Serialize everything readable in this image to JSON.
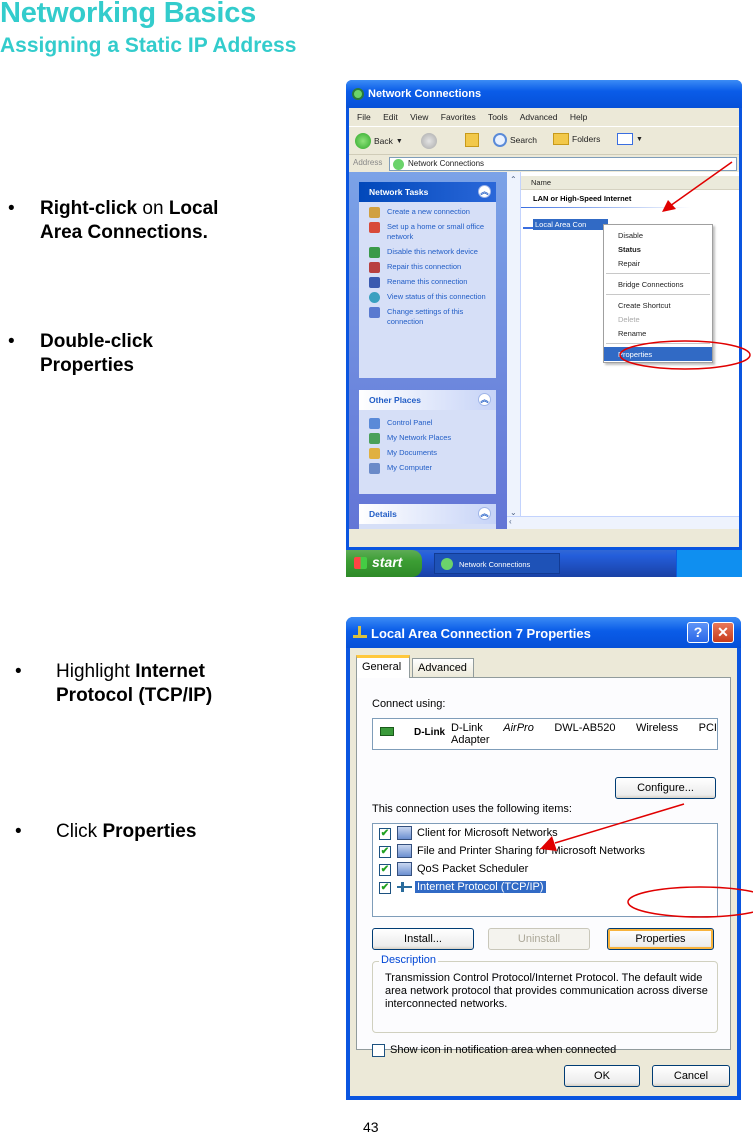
{
  "page": {
    "title": "Networking Basics",
    "subtitle": "Assigning a Static IP Address",
    "page_number": "43"
  },
  "instructions": [
    {
      "parts": [
        {
          "text": "Right-click",
          "bold": true
        },
        {
          "text": " on ",
          "bold": false
        },
        {
          "text": "Local Area Connections.",
          "bold": true
        }
      ]
    },
    {
      "parts": [
        {
          "text": "Double-click Properties",
          "bold": true
        }
      ]
    },
    {
      "parts": [
        {
          "text": "Highlight ",
          "bold": false
        },
        {
          "text": "Internet Protocol (TCP/IP)",
          "bold": true
        }
      ]
    },
    {
      "parts": [
        {
          "text": "Click ",
          "bold": false
        },
        {
          "text": "Properties",
          "bold": true
        }
      ]
    }
  ],
  "instr_text": {
    "i1_a": "Right-click",
    "i1_b": " on ",
    "i1_c": "Local",
    "i1_d": "Area Connections.",
    "i2_a": "Double-click",
    "i2_b": "Properties",
    "i3_a": "Highlight ",
    "i3_b": "Internet",
    "i3_c": "Protocol (TCP/IP)",
    "i4_a": "Click ",
    "i4_b": "Properties",
    "bullet": "•"
  },
  "network_connections": {
    "window_title": "Network Connections",
    "menu": [
      "File",
      "Edit",
      "View",
      "Favorites",
      "Tools",
      "Advanced",
      "Help"
    ],
    "toolbar": {
      "back": "Back",
      "search": "Search",
      "folders": "Folders"
    },
    "address_label": "Address",
    "address_value": "Network Connections",
    "network_tasks": {
      "header": "Network Tasks",
      "items": [
        "Create a new connection",
        "Set up a home or small office network",
        "Disable this network device",
        "Repair this connection",
        "Rename this connection",
        "View status of this connection",
        "Change settings of this connection"
      ]
    },
    "other_places": {
      "header": "Other Places",
      "items": [
        "Control Panel",
        "My Network Places",
        "My Documents",
        "My Computer"
      ]
    },
    "details_header": "Details",
    "column_header": "Name",
    "group_label": "LAN or High-Speed Internet",
    "connection_item": "Local Area Con",
    "context_menu": [
      {
        "label": "Disable",
        "style": "normal"
      },
      {
        "label": "Status",
        "style": "bold"
      },
      {
        "label": "Repair",
        "style": "normal"
      },
      {
        "label": "Bridge Connections",
        "style": "normal"
      },
      {
        "label": "Create Shortcut",
        "style": "normal"
      },
      {
        "label": "Delete",
        "style": "disabled"
      },
      {
        "label": "Rename",
        "style": "normal"
      },
      {
        "label": "Properties",
        "style": "highlighted"
      }
    ],
    "taskbar": {
      "start": "start",
      "task_button": "Network Connections"
    }
  },
  "properties_dialog": {
    "title": "Local Area Connection 7 Properties",
    "help_btn": "?",
    "close_btn": "✕",
    "tabs": [
      "General",
      "Advanced"
    ],
    "connect_using_label": "Connect using:",
    "adapter_brand": "D-Link",
    "adapter_name_words": [
      "D-Link",
      "AirPro",
      "DWL-AB520",
      "Wireless",
      "PCI"
    ],
    "adapter_name_line2": "Adapter",
    "configure_btn": "Configure...",
    "items_label": "This connection uses the following items:",
    "items": [
      {
        "label": "Client for Microsoft Networks",
        "checked": true,
        "selected": false
      },
      {
        "label": "File and Printer Sharing for Microsoft Networks",
        "checked": true,
        "selected": false
      },
      {
        "label": "QoS Packet Scheduler",
        "checked": true,
        "selected": false
      },
      {
        "label": "Internet Protocol (TCP/IP)",
        "checked": true,
        "selected": true
      }
    ],
    "install_btn": "Install...",
    "uninstall_btn": "Uninstall",
    "properties_btn": "Properties",
    "description_legend": "Description",
    "description_text": "Transmission Control Protocol/Internet Protocol. The default wide area network protocol that provides communication across diverse interconnected networks.",
    "show_icon_label": "Show icon in notification area when connected",
    "show_icon_checked": false,
    "ok_btn": "OK",
    "cancel_btn": "Cancel",
    "check_glyph": "✔"
  },
  "colors": {
    "heading": "#33cccc",
    "xp_blue": "#0a55e0",
    "selection": "#316ac5",
    "annotation_red": "#e00000"
  }
}
